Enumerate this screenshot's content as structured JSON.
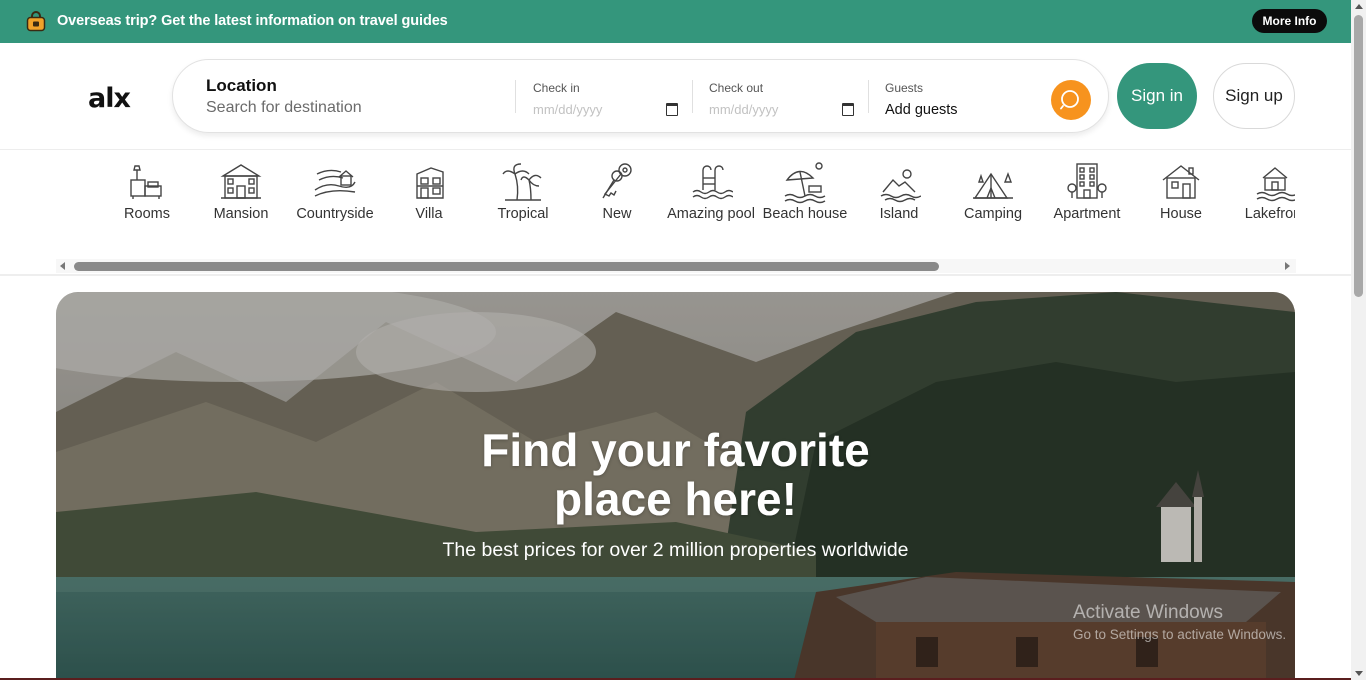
{
  "announcement": {
    "message": "Overseas trip? Get the latest information on travel guides",
    "button": "More Info",
    "icon": "shopping-bag-lock-icon"
  },
  "header": {
    "logo": "alx",
    "search": {
      "location_label": "Location",
      "location_placeholder": "Search for destination",
      "checkin_label": "Check in",
      "checkin_placeholder": "mm/dd/yyyy",
      "checkout_label": "Check out",
      "checkout_placeholder": "mm/dd/yyyy",
      "guests_label": "Guests",
      "guests_value": "Add guests"
    },
    "signin": "Sign in",
    "signup": "Sign up"
  },
  "categories": [
    {
      "label": "Rooms",
      "icon": "rooms-icon"
    },
    {
      "label": "Mansion",
      "icon": "mansion-icon"
    },
    {
      "label": "Countryside",
      "icon": "countryside-icon"
    },
    {
      "label": "Villa",
      "icon": "villa-icon"
    },
    {
      "label": "Tropical",
      "icon": "palm-tree-icon"
    },
    {
      "label": "New",
      "icon": "keys-icon"
    },
    {
      "label": "Amazing pool",
      "icon": "pool-icon"
    },
    {
      "label": "Beach house",
      "icon": "beach-umbrella-icon"
    },
    {
      "label": "Island",
      "icon": "island-icon"
    },
    {
      "label": "Camping",
      "icon": "tent-icon"
    },
    {
      "label": "Apartment",
      "icon": "apartment-icon"
    },
    {
      "label": "House",
      "icon": "house-icon"
    },
    {
      "label": "Lakefront",
      "icon": "lakefront-icon"
    }
  ],
  "hero": {
    "title_line1": "Find your favorite",
    "title_line2": "place here!",
    "subtitle": "The best prices for over 2 million properties worldwide"
  },
  "watermark": {
    "line1": "Activate Windows",
    "line2": "Go to Settings to activate Windows."
  },
  "colors": {
    "brand": "#34967c",
    "accent": "#f7931e",
    "dark_button": "#0b0b0b"
  }
}
